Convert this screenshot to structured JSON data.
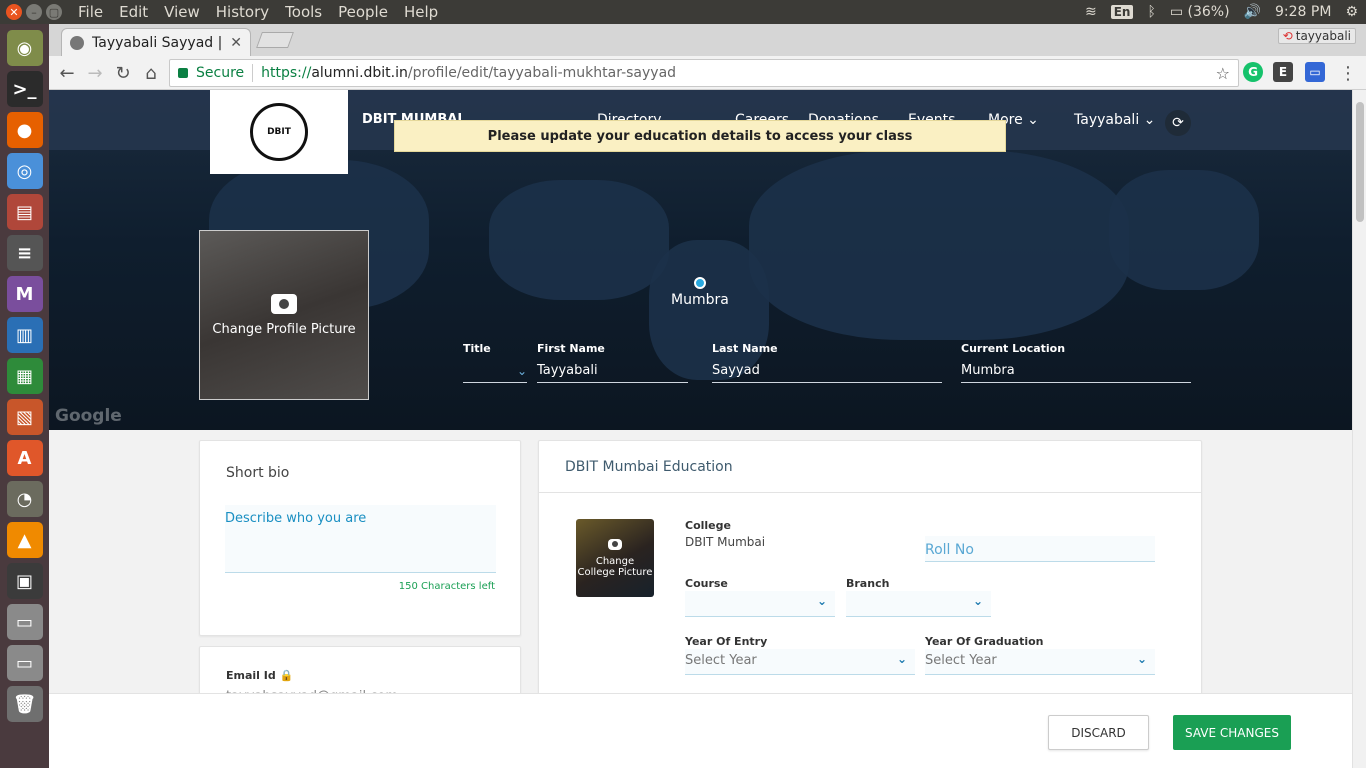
{
  "os_panel": {
    "menu": [
      "File",
      "Edit",
      "View",
      "History",
      "Tools",
      "People",
      "Help"
    ],
    "lang": "En",
    "battery": "(36%)",
    "time": "9:28 PM"
  },
  "browser": {
    "tab_title": "Tayyabali Sayyad | D",
    "profile_name": "tayyabali",
    "secure_label": "Secure",
    "url_proto": "https://",
    "url_host": "alumni.dbit.in",
    "url_path": "/profile/edit/tayyabali-mukhtar-sayyad"
  },
  "site": {
    "brand": "DBIT MUMBAI",
    "nav": [
      "Directory",
      "Careers",
      "Donations",
      "Events",
      "More",
      "Tayyabali"
    ],
    "banner": "Please update your education details to access your class",
    "logo_text": "TECHNOLOGY FOR THE YOUNG · DBIT"
  },
  "hero": {
    "change_picture": "Change Profile Picture",
    "location_pin": "Mumbra",
    "map_watermark": "Google",
    "fields": {
      "title_label": "Title",
      "title_value": "",
      "first_name_label": "First Name",
      "first_name_value": "Tayyabali",
      "last_name_label": "Last Name",
      "last_name_value": "Sayyad",
      "location_label": "Current Location",
      "location_value": "Mumbra"
    }
  },
  "bio": {
    "title": "Short bio",
    "placeholder": "Describe who you are",
    "counter": "150 Characters left"
  },
  "email": {
    "label": "Email Id",
    "value": "tayyabsayyad@gmail.com"
  },
  "education": {
    "header": "DBIT Mumbai Education",
    "change_college_picture": "Change College Picture",
    "college_label": "College",
    "college_value": "DBIT Mumbai",
    "roll_placeholder": "Roll No",
    "course_label": "Course",
    "branch_label": "Branch",
    "entry_label": "Year Of Entry",
    "entry_value": "Select Year",
    "graduation_label": "Year Of Graduation",
    "graduation_value": "Select Year"
  },
  "footer": {
    "discard": "DISCARD",
    "save": "SAVE CHANGES"
  }
}
